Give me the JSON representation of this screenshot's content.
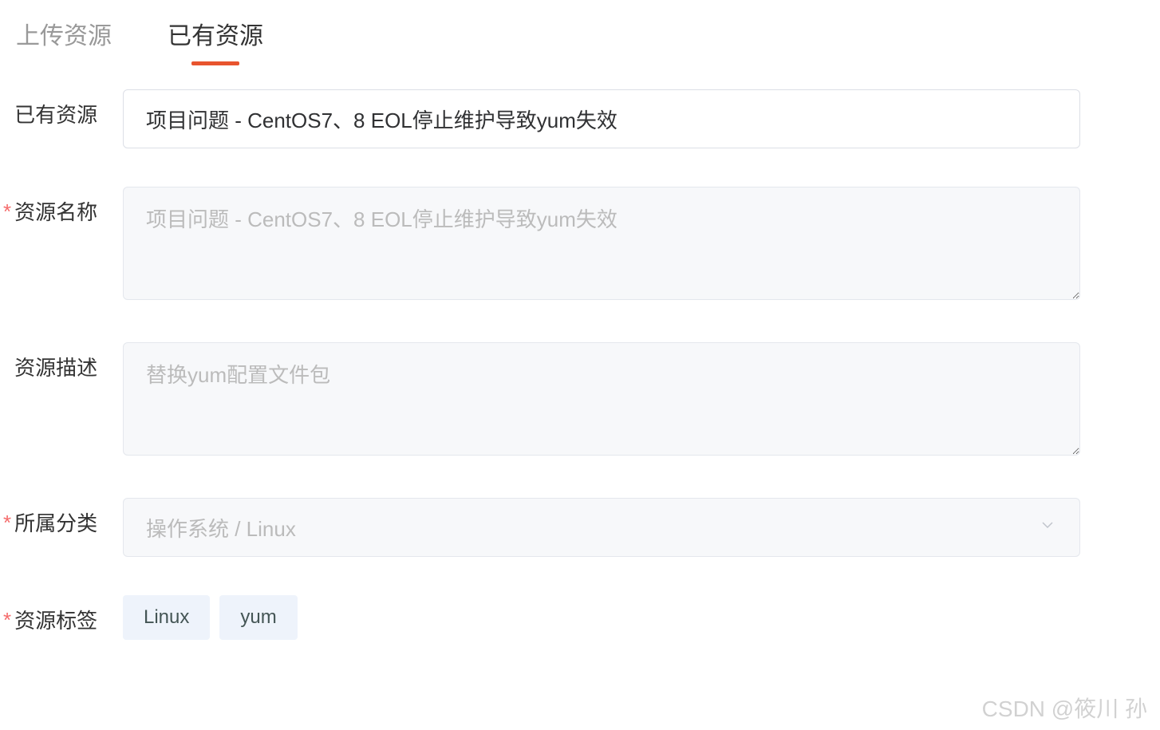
{
  "tabs": {
    "upload": "上传资源",
    "existing": "已有资源"
  },
  "form": {
    "existing_resource": {
      "label": "已有资源",
      "value": "项目问题 - CentOS7、8 EOL停止维护导致yum失效"
    },
    "resource_name": {
      "label": "资源名称",
      "placeholder": "项目问题 - CentOS7、8 EOL停止维护导致yum失效"
    },
    "resource_description": {
      "label": "资源描述",
      "placeholder": "替换yum配置文件包"
    },
    "category": {
      "label": "所属分类",
      "value": "操作系统 / Linux"
    },
    "tags": {
      "label": "资源标签",
      "items": [
        "Linux",
        "yum"
      ]
    }
  },
  "watermark": "CSDN @筱川 孙"
}
